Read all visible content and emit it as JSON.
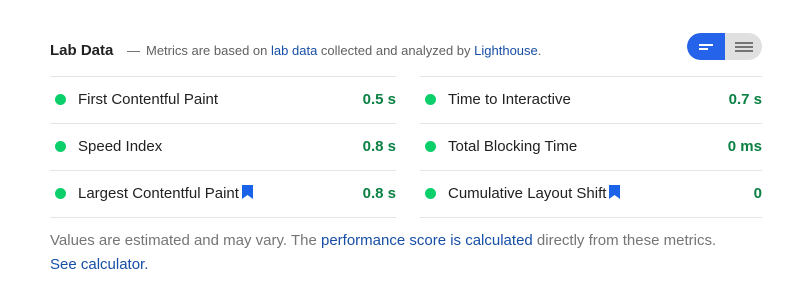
{
  "header": {
    "title": "Lab Data",
    "dash": "—",
    "desc_prefix": "Metrics are based on",
    "desc_link1": "lab data",
    "desc_middle": "collected and analyzed by",
    "desc_link2": "Lighthouse",
    "desc_suffix": "."
  },
  "toggle": {
    "left_icon": "bar-view-icon",
    "right_icon": "list-view-icon",
    "active": "left"
  },
  "metrics_left": [
    {
      "name": "First Contentful Paint",
      "value": "0.5 s",
      "bookmark": false
    },
    {
      "name": "Speed Index",
      "value": "0.8 s",
      "bookmark": false
    },
    {
      "name": "Largest Contentful Paint",
      "value": "0.8 s",
      "bookmark": true
    }
  ],
  "metrics_right": [
    {
      "name": "Time to Interactive",
      "value": "0.7 s",
      "bookmark": false
    },
    {
      "name": "Total Blocking Time",
      "value": "0 ms",
      "bookmark": false
    },
    {
      "name": "Cumulative Layout Shift",
      "value": "0",
      "bookmark": true
    }
  ],
  "footer": {
    "text1": "Values are estimated and may vary. The",
    "link1": "performance score is calculated",
    "text2": "directly from these metrics.",
    "link2": "See calculator."
  },
  "colors": {
    "pass": "#0cce6b",
    "value": "#0a8043",
    "link": "#174ea6",
    "toggle_active": "#2563eb"
  }
}
